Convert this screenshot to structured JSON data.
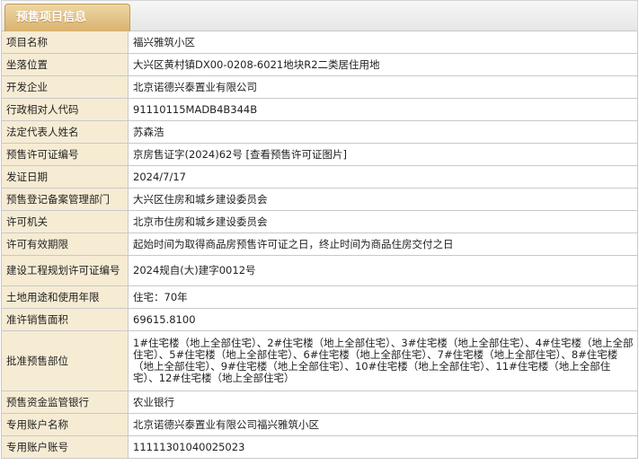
{
  "panel": {
    "tab_label": "预售项目信息"
  },
  "rows": [
    {
      "label": "项目名称",
      "value": "福兴雅筑小区"
    },
    {
      "label": "坐落位置",
      "value": "大兴区黄村镇DX00-0208-6021地块R2二类居住用地"
    },
    {
      "label": "开发企业",
      "value": "北京诺德兴泰置业有限公司"
    },
    {
      "label": "行政相对人代码",
      "value": "91110115MADB4B344B"
    },
    {
      "label": "法定代表人姓名",
      "value": "苏森浩"
    },
    {
      "label": "预售许可证编号",
      "value": "京房售证字(2024)62号",
      "link": "[查看预售许可证图片]"
    },
    {
      "label": "发证日期",
      "value": "2024/7/17"
    },
    {
      "label": "预售登记备案管理部门",
      "value": "大兴区住房和城乡建设委员会"
    },
    {
      "label": "许可机关",
      "value": "北京市住房和城乡建设委员会"
    },
    {
      "label": "许可有效期限",
      "value": "起始时间为取得商品房预售许可证之日，终止时间为商品住房交付之日"
    },
    {
      "label": "建设工程规划许可证编号",
      "value": "2024规自(大)建字0012号"
    },
    {
      "label": "土地用途和使用年限",
      "value": "住宅：70年"
    },
    {
      "label": "准许销售面积",
      "value": "69615.8100"
    },
    {
      "label": "批准预售部位",
      "value": "1#住宅楼（地上全部住宅）、2#住宅楼（地上全部住宅）、3#住宅楼（地上全部住宅）、4#住宅楼（地上全部住宅）、5#住宅楼（地上全部住宅）、6#住宅楼（地上全部住宅）、7#住宅楼（地上全部住宅）、8#住宅楼（地上全部住宅）、9#住宅楼（地上全部住宅）、10#住宅楼（地上全部住宅）、11#住宅楼（地上全部住宅）、12#住宅楼（地上全部住宅）"
    },
    {
      "label": "预售资金监管银行",
      "value": "农业银行"
    },
    {
      "label": "专用账户名称",
      "value": "北京诺德兴泰置业有限公司福兴雅筑小区"
    },
    {
      "label": "专用账户账号",
      "value": "11111301040025023"
    }
  ]
}
